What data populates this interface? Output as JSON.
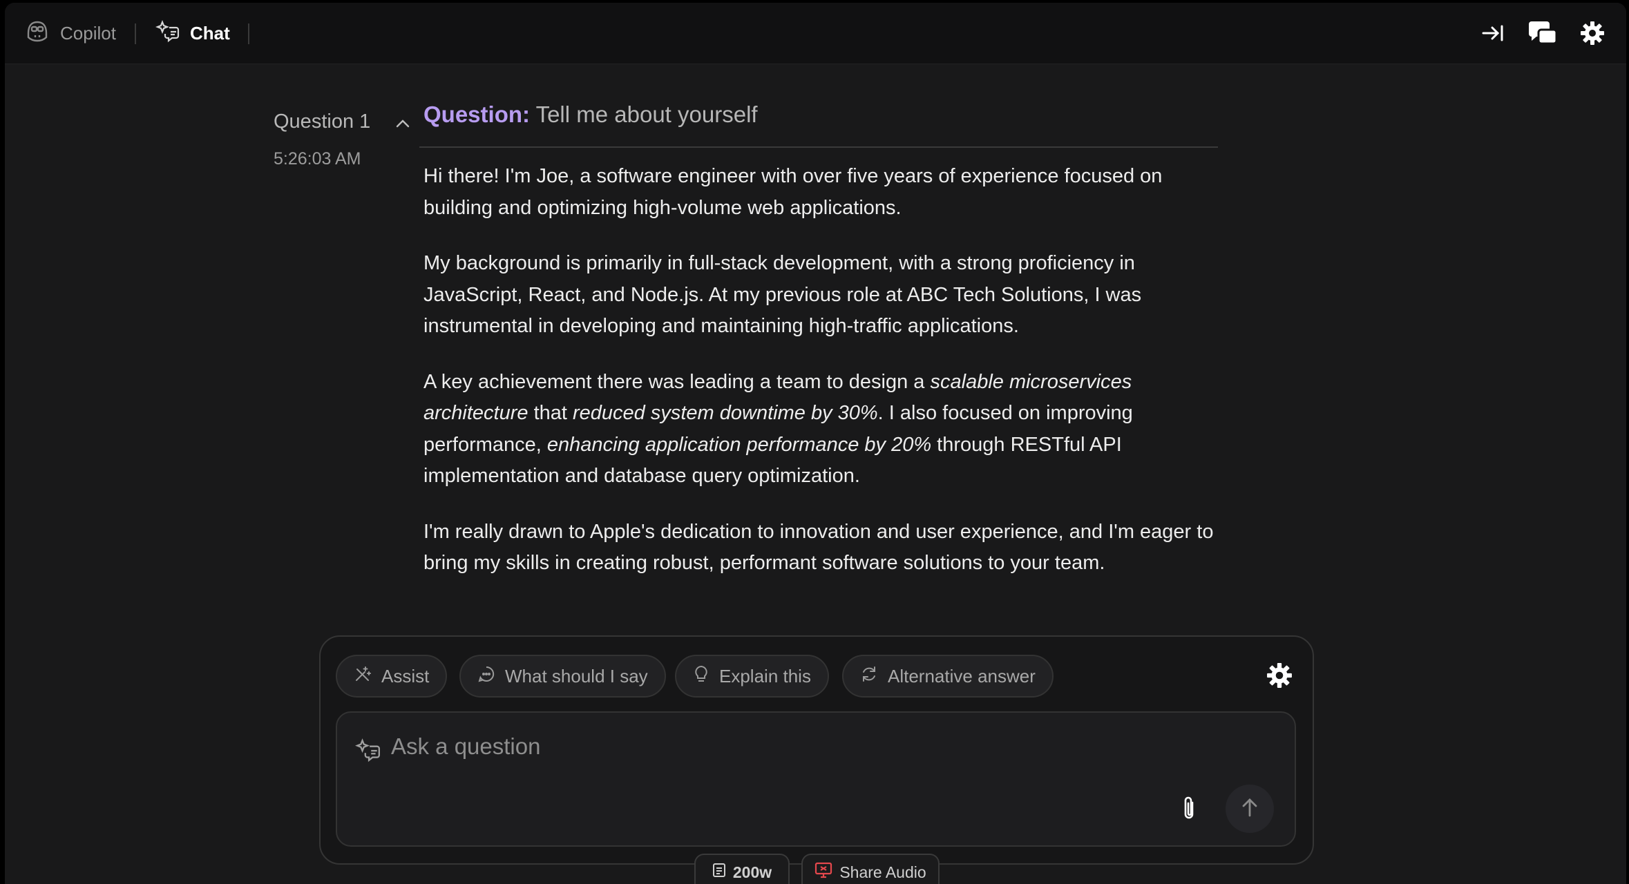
{
  "topbar": {
    "tabs": [
      {
        "label": "Copilot",
        "icon": "copilot-icon"
      },
      {
        "label": "Chat",
        "icon": "chat-sparkle-icon"
      }
    ],
    "right_icons": [
      "collapse-panel-icon",
      "chat-bubbles-icon",
      "gear-icon"
    ]
  },
  "question": {
    "number_label": "Question 1",
    "time": "5:26:03 AM",
    "label": "Question:",
    "text": "Tell me about yourself"
  },
  "answer": {
    "p1": "Hi there! I'm Joe, a software engineer with over five years of experience focused on building and optimizing high-volume web applications.",
    "p2": "My background is primarily in full-stack development, with a strong proficiency in JavaScript, React, and Node.js. At my previous role at ABC Tech Solutions, I was instrumental in developing and maintaining high-traffic applications.",
    "p3": {
      "t1": "A key achievement there was leading a team to design a ",
      "e1": "scalable microservices architecture",
      "t2": " that ",
      "e2": "reduced system downtime by 30%",
      "t3": ". I also focused on improving performance, ",
      "e3": "enhancing application performance by 20%",
      "t4": " through RESTful API implementation and database query optimization."
    },
    "p4": "I'm really drawn to Apple's dedication to innovation and user experience, and I'm eager to bring my skills in creating robust, performant software solutions to your team."
  },
  "composer": {
    "actions": [
      {
        "label": "Assist",
        "icon": "assist-icon"
      },
      {
        "label": "What should I say",
        "icon": "chat-dots-icon"
      },
      {
        "label": "Explain this",
        "icon": "lightbulb-icon"
      },
      {
        "label": "Alternative answer",
        "icon": "refresh-icon"
      }
    ],
    "placeholder": "Ask a question"
  },
  "footer": {
    "word_count": "200w",
    "share_audio": "Share Audio"
  },
  "colors": {
    "background": "#19191a",
    "topbar": "#111112",
    "accent_purple": "#b79cf0",
    "share_audio_red": "#e5484d"
  }
}
